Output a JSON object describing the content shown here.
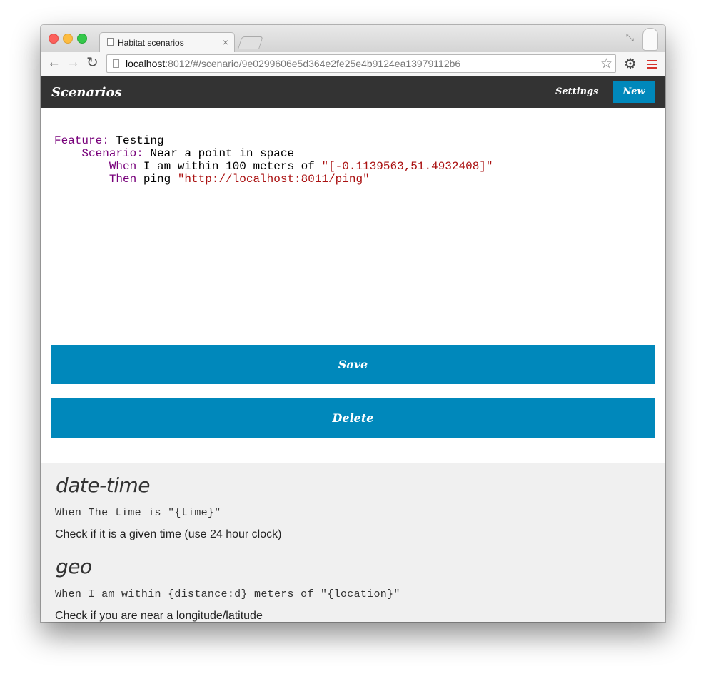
{
  "browser": {
    "tab_title": "Habitat scenarios",
    "tab_close": "×",
    "url_host": "localhost",
    "url_rest": ":8012/#/scenario/9e0299606e5d364e2fe25e4b9124ea13979112b6",
    "icons": {
      "back": "←",
      "forward": "→",
      "reload": "↻",
      "star": "☆",
      "gear": "⚙",
      "fullscreen": "⤡"
    }
  },
  "navbar": {
    "brand": "Scenarios",
    "settings_label": "Settings",
    "new_label": "New",
    "accent_color": "#0088bb",
    "bar_color": "#333333"
  },
  "editor": {
    "line1_kw": "Feature:",
    "line1_text": " Testing",
    "line2_kw": "Scenario:",
    "line2_text": " Near a point in space",
    "line3_kw": "When",
    "line3_text": " I am within 100 meters of ",
    "line3_str": "\"[-0.1139563,51.4932408]\"",
    "line4_kw": "Then",
    "line4_text": " ping ",
    "line4_str": "\"http://localhost:8011/ping\""
  },
  "actions": {
    "save_label": "Save",
    "delete_label": "Delete"
  },
  "steps": [
    {
      "name": "date-time",
      "pattern": "When The time is \"{time}\"",
      "description": "Check if it is a given time (use 24 hour clock)"
    },
    {
      "name": "geo",
      "pattern": "When I am within {distance:d} meters of \"{location}\"",
      "description": "Check if you are near a longitude/latitude"
    }
  ]
}
